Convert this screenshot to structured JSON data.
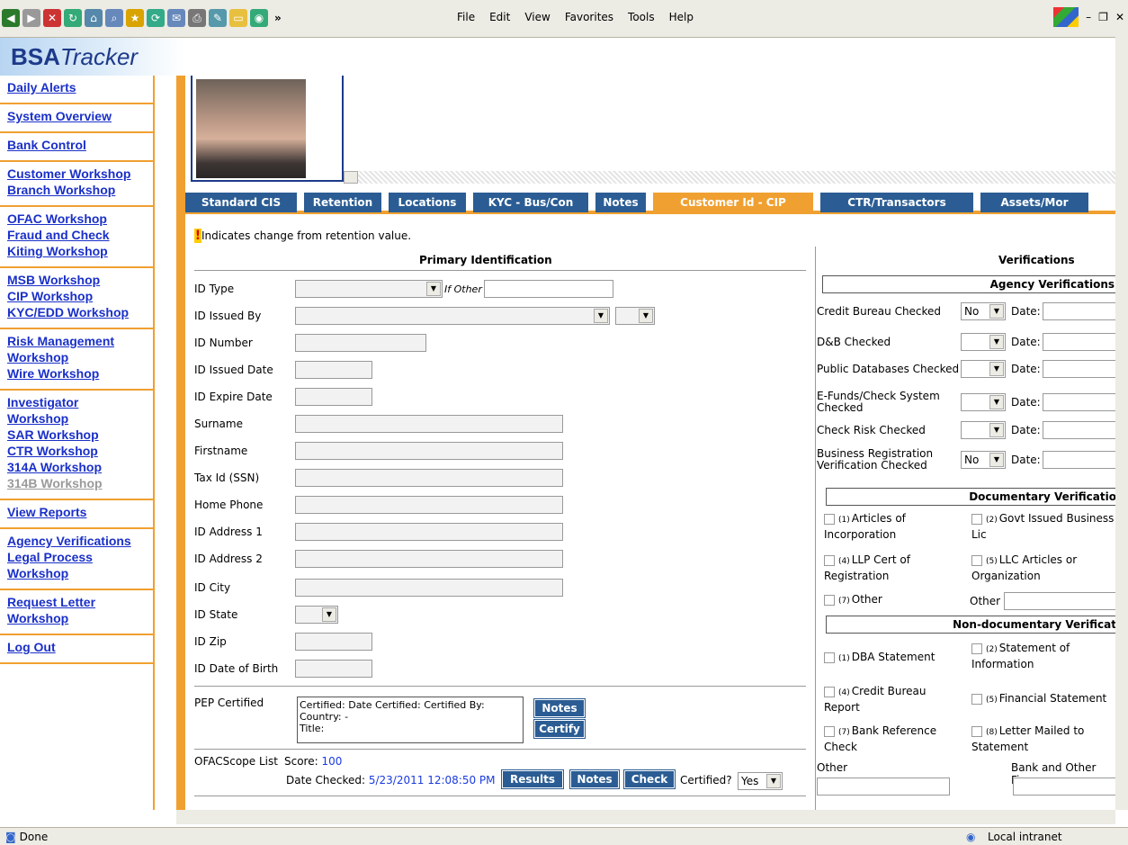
{
  "browser": {
    "menu": [
      "File",
      "Edit",
      "View",
      "Favorites",
      "Tools",
      "Help"
    ],
    "status_left": "Done",
    "status_zone": "Local intranet",
    "window_controls": [
      "–",
      "❐",
      "✕"
    ]
  },
  "app": {
    "logo_bold": "BSA",
    "logo_italic": "Tracker"
  },
  "sidebar": {
    "groups": [
      [
        "Daily Alerts"
      ],
      [
        "System Overview"
      ],
      [
        "Bank Control"
      ],
      [
        "Customer Workshop",
        "Branch Workshop"
      ],
      [
        "OFAC Workshop",
        "Fraud and Check",
        "Kiting Workshop"
      ],
      [
        "MSB Workshop",
        "CIP Workshop",
        "KYC/EDD Workshop"
      ],
      [
        "Risk Management",
        "Workshop",
        "Wire Workshop"
      ],
      [
        "Investigator",
        "Workshop",
        "SAR Workshop",
        "CTR Workshop",
        "314A Workshop",
        "314B Workshop"
      ],
      [
        "View Reports"
      ],
      [
        "Agency Verifications",
        "Legal Process",
        "Workshop"
      ],
      [
        "Request Letter",
        "Workshop"
      ],
      [
        "Log Out"
      ]
    ]
  },
  "tabs": [
    {
      "label": "Standard CIS",
      "active": false
    },
    {
      "label": "Retention",
      "active": false
    },
    {
      "label": "Locations",
      "active": false
    },
    {
      "label": "KYC - Bus/Con",
      "active": false
    },
    {
      "label": "Notes",
      "active": false
    },
    {
      "label": "Customer Id - CIP",
      "active": true
    },
    {
      "label": "CTR/Transactors",
      "active": false
    },
    {
      "label": "Assets/Mor",
      "active": false
    }
  ],
  "legend": {
    "mark": "!",
    "text": "Indicates change from retention value."
  },
  "primary": {
    "title": "Primary Identification",
    "if_other": "If Other",
    "fields": [
      "ID Type",
      "ID Issued By",
      "ID Number",
      "ID Issued Date",
      "ID Expire Date",
      "Surname",
      "Firstname",
      "Tax Id (SSN)",
      "Home Phone",
      "ID Address 1",
      "ID Address 2",
      "ID City",
      "ID State",
      "ID Zip",
      "ID Date of Birth"
    ],
    "pep_label": "PEP Certified",
    "pep_lines": [
      "Certified:   Date Certified:   Certified By:",
      "Country:  -",
      "Title:"
    ],
    "notes_label": "Notes",
    "certify_label": "Certify",
    "ofac_label": "OFACScope List",
    "score_prefix": "Score: ",
    "score_value": "100",
    "date_checked_prefix": "Date Checked: ",
    "date_checked_value": "5/23/2011 12:08:50 PM",
    "results_label": "Results",
    "notes2_label": "Notes",
    "check_label": "Check",
    "certified_q": "Certified?",
    "certified_value": "Yes"
  },
  "verifications": {
    "title": "Verifications",
    "agency_head": "Agency Verifications",
    "date_label": "Date:",
    "agency_rows": [
      {
        "label": "Credit Bureau Checked",
        "value": "No"
      },
      {
        "label": "D&B Checked",
        "value": ""
      },
      {
        "label": "Public Databases Checked",
        "value": ""
      },
      {
        "label": "E-Funds/Check System Checked",
        "value": ""
      },
      {
        "label": "Check Risk Checked",
        "value": ""
      },
      {
        "label": "Business Registration Verification Checked",
        "value": "No"
      }
    ],
    "doc_head": "Documentary Verificatio",
    "doc_items": [
      [
        "(1)",
        "Articles of",
        "Incorporation"
      ],
      [
        "(2)",
        "Govt Issued Business",
        "Lic"
      ],
      [
        "(4)",
        "LLP Cert of",
        "Registration"
      ],
      [
        "(5)",
        "LLC Articles or",
        "Organization"
      ],
      [
        "(7)",
        "Other",
        ""
      ]
    ],
    "other_label": "Other",
    "nondoc_head": "Non-documentary Verificat",
    "nondoc_items": [
      [
        "(1)",
        "DBA Statement",
        ""
      ],
      [
        "(2)",
        "Statement of",
        "Information"
      ],
      [
        "(4)",
        "Credit Bureau",
        "Report"
      ],
      [
        "(5)",
        "Financial Statement",
        ""
      ],
      [
        "(7)",
        "Bank Reference",
        "Check"
      ],
      [
        "(8)",
        "Letter Mailed to",
        "Statement"
      ]
    ],
    "other2_label": "Other",
    "bank_other_label": "Bank and Other Finar"
  }
}
